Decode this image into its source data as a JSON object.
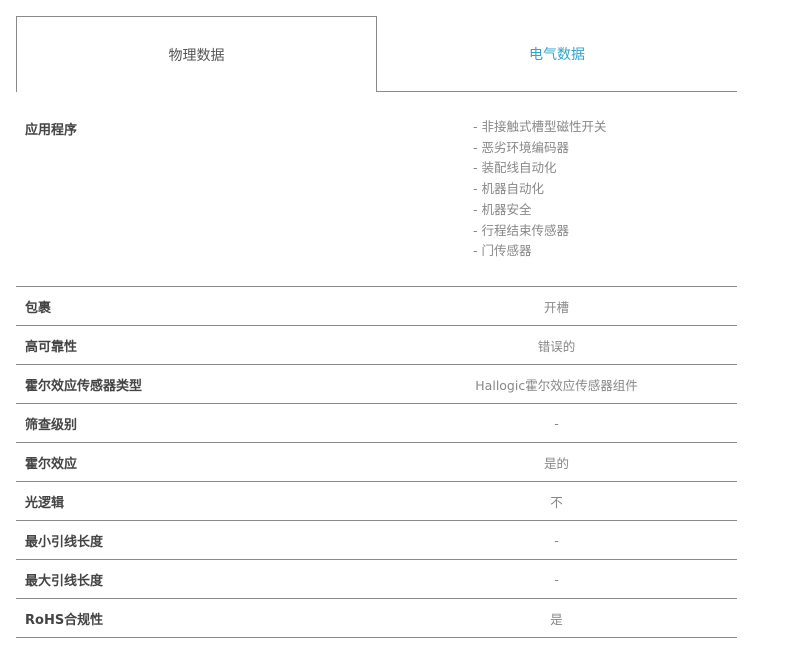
{
  "tabs": {
    "physical_label": "物理数据",
    "electrical_label": "电气数据"
  },
  "applications": {
    "label": "应用程序",
    "items": [
      "- 非接触式槽型磁性开关",
      "- 恶劣环境编码器",
      "- 装配线自动化",
      "- 机器自动化",
      "- 机器安全",
      "- 行程结束传感器",
      "- 门传感器"
    ]
  },
  "rows": [
    {
      "label": "包裹",
      "value": "开槽"
    },
    {
      "label": "高可靠性",
      "value": "错误的"
    },
    {
      "label": "霍尔效应传感器类型",
      "value": "Hallogic霍尔效应传感器组件"
    },
    {
      "label": "筛查级别",
      "value": "-"
    },
    {
      "label": "霍尔效应",
      "value": "是的"
    },
    {
      "label": "光逻辑",
      "value": "不"
    },
    {
      "label": "最小引线长度",
      "value": "-"
    },
    {
      "label": "最大引线长度",
      "value": "-"
    },
    {
      "label": "RoHS合规性",
      "value": "是"
    }
  ],
  "colors": {
    "active_tab_text": "#555555",
    "inactive_tab_text": "#2fa4c9",
    "divider": "#8a8a8a",
    "value_text": "#888888"
  }
}
